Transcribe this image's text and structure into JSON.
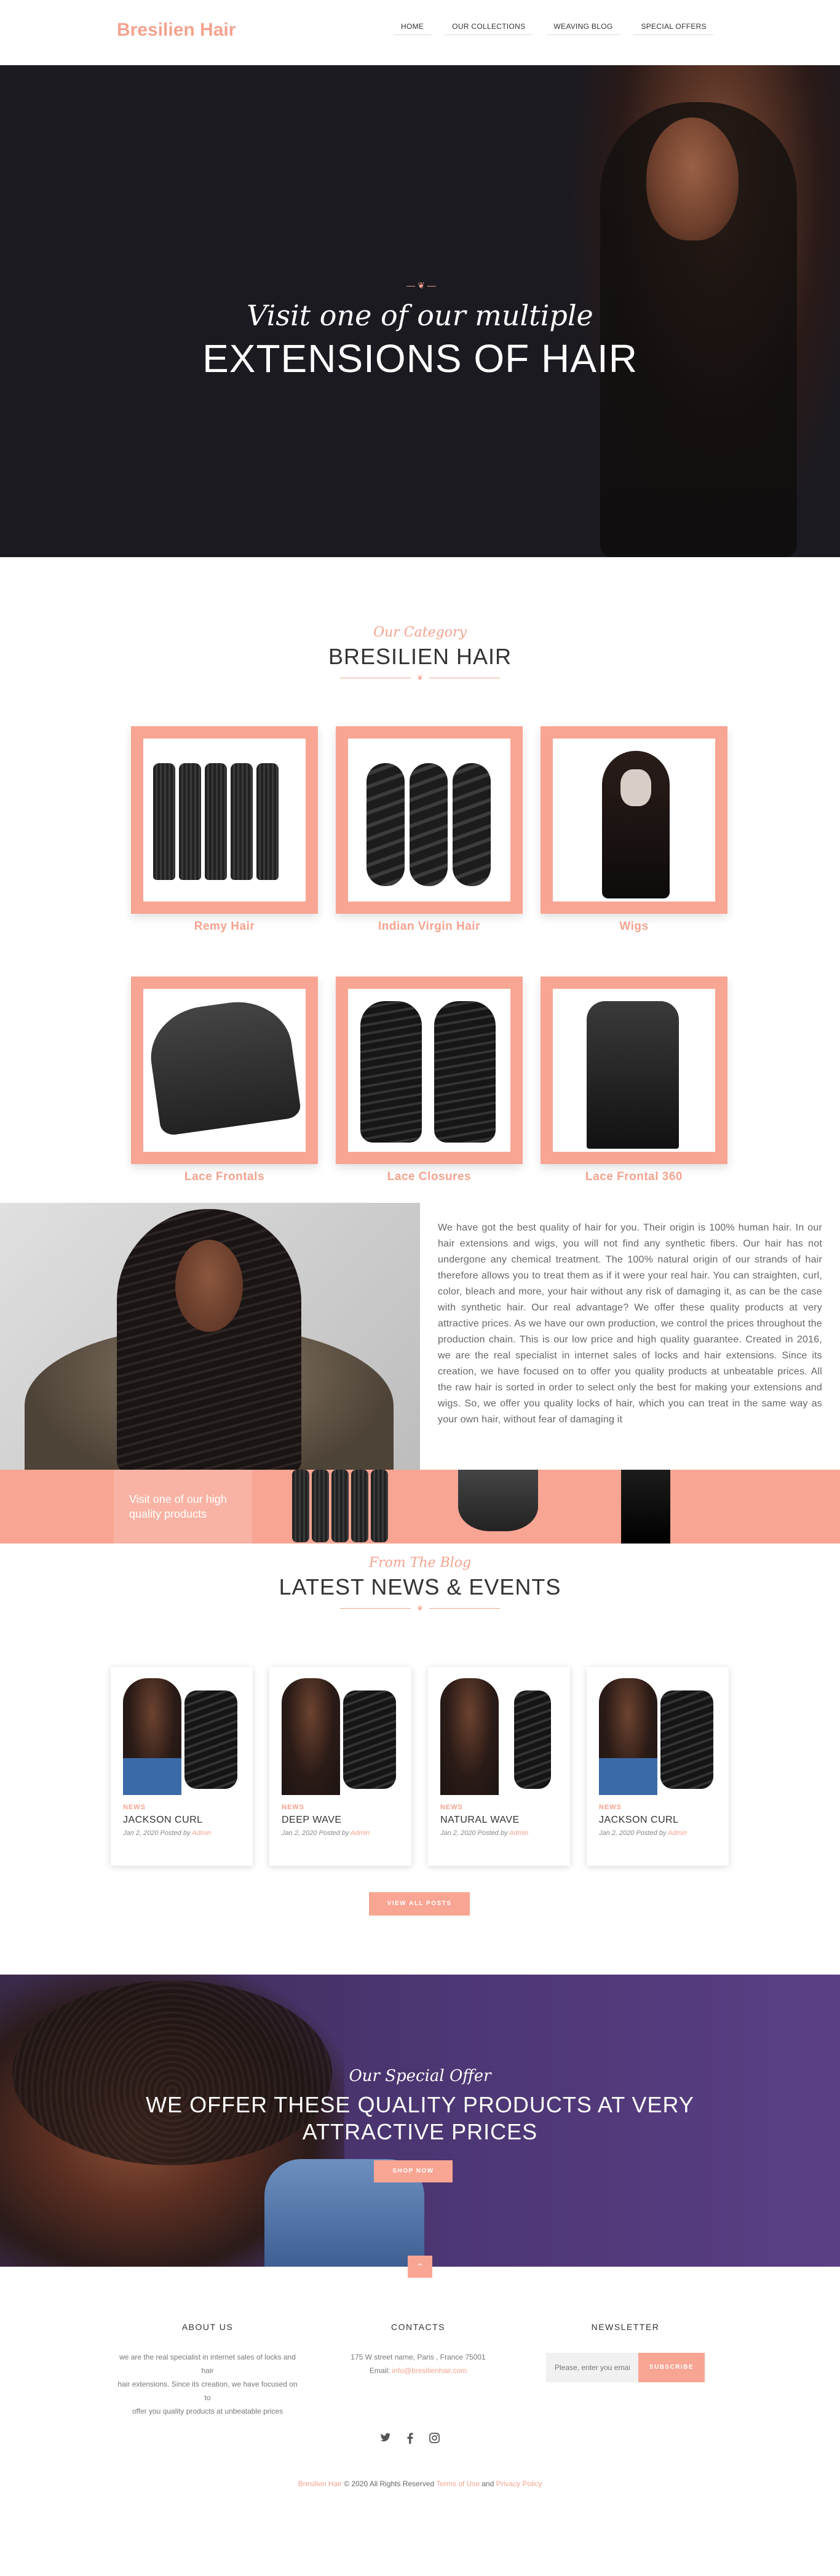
{
  "header": {
    "logo": "Bresilien Hair",
    "nav": [
      "HOME",
      "OUR COLLECTIONS",
      "WEAVING BLOG",
      "SPECIAL OFFERS"
    ]
  },
  "hero": {
    "script": "Visit one of our multiple",
    "title": "EXTENSIONS OF HAIR"
  },
  "category": {
    "subtitle": "Our Category",
    "title": "BRESILIEN HAIR",
    "items": [
      "Remy Hair",
      "Indian Virgin Hair",
      "Wigs",
      "Lace Frontals",
      "Lace Closures",
      "Lace Frontal 360"
    ]
  },
  "about": {
    "text": "We have got the best quality of hair for you. Their origin is 100% human hair. In our hair extensions and wigs, you will not find any synthetic fibers. Our hair has not undergone any chemical treatment. The 100% natural origin of our strands of hair therefore allows you to treat them as if it were your real hair. You can straighten, curl, color, bleach and more, your hair without any risk of damaging it, as can be the case with synthetic hair. Our real advantage? We offer these quality products at very attractive prices.  As we have our own production, we control the prices throughout the production chain. This is our low price and high quality guarantee. Created in 2016, we are the real specialist in internet sales of locks and hair extensions. Since its creation, we have focused on to offer you quality products at unbeatable prices. All the raw hair is sorted in order to select only the best for making your extensions and wigs. So, we offer you quality locks of hair, which you can treat in the same way as your own hair, without fear of damaging it",
    "strip_text": "Visit one of our high quality products"
  },
  "news": {
    "subtitle": "From The Blog",
    "title": "LATEST NEWS & EVENTS",
    "posts": [
      {
        "tag": "NEWS",
        "title": "JACKSON CURL",
        "date": "Jan 2, 2020 Posted by",
        "author": "Admin"
      },
      {
        "tag": "NEWS",
        "title": "DEEP WAVE",
        "date": "Jan 2, 2020 Posted by",
        "author": "Admin"
      },
      {
        "tag": "NEWS",
        "title": "NATURAL WAVE",
        "date": "Jan 2, 2020 Posted by",
        "author": "Admin"
      },
      {
        "tag": "NEWS",
        "title": "JACKSON CURL",
        "date": "Jan 2, 2020 Posted by",
        "author": "Admin"
      }
    ],
    "view_all": "VIEW ALL POSTS"
  },
  "offer": {
    "script": "Our Special Offer",
    "title_line1": "WE OFFER THESE QUALITY PRODUCTS AT VERY",
    "title_line2": "ATTRACTIVE PRICES",
    "button": "SHOP NOW",
    "to_top": "^"
  },
  "footer": {
    "about_title": "ABOUT US",
    "about_l1": "we are the real specialist in internet sales of locks and hair",
    "about_l2": "hair extensions. Since its creation, we have focused on to",
    "about_l3": "offer you quality products at unbeatable prices",
    "contact_title": "CONTACTS",
    "contact_addr": "175 W street name, Paris , France 75001",
    "contact_email_label": "Email:",
    "contact_email": "info@bresilienhair.com",
    "newsletter_title": "NEWSLETTER",
    "newsletter_placeholder": "Please, enter you email",
    "subscribe": "SUBSCRIBE",
    "social": [
      "twitter-icon",
      "facebook-icon",
      "instagram-icon"
    ],
    "copy_brand": "Bresilien Hair",
    "copy_text": "© 2020 All Rights Reserved",
    "copy_terms": "Terms of Use",
    "copy_and": "and",
    "copy_privacy": "Privacy Policy"
  },
  "colors": {
    "accent": "#f8a593",
    "dark": "#1b1a21",
    "purple": "#4a3570"
  }
}
